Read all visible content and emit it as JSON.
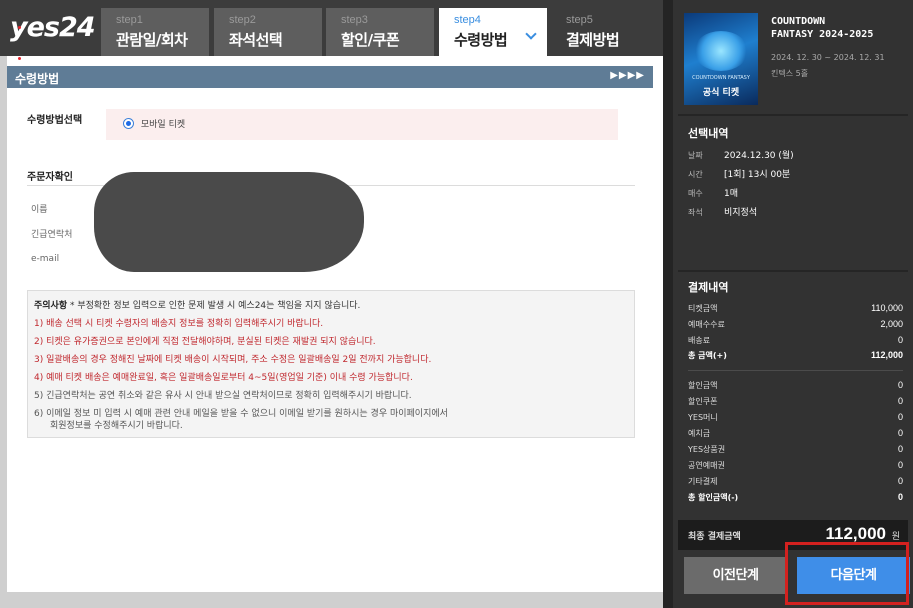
{
  "header": {
    "logo": "yes24",
    "steps": [
      {
        "num": "step1",
        "label": "관람일/회차",
        "state": "gray"
      },
      {
        "num": "step2",
        "label": "좌석선택",
        "state": "gray"
      },
      {
        "num": "step3",
        "label": "할인/쿠폰",
        "state": "gray"
      },
      {
        "num": "step4",
        "label": "수령방법",
        "state": "active"
      },
      {
        "num": "step5",
        "label": "결제방법",
        "state": "dark"
      }
    ]
  },
  "section": {
    "title": "수령방법",
    "arrows": "▶▶▶▶"
  },
  "receive": {
    "label": "수령방법선택",
    "option": "모바일 티켓",
    "selected": true
  },
  "orderer": {
    "title": "주문자확인",
    "fields": [
      "이름",
      "긴급연락처",
      "e-mail"
    ]
  },
  "notice": {
    "title_bold": "주의사항",
    "title_rest": " * 부정확한 정보 입력으로 인한 문제 발생 시 예스24는 책임을 지지 않습니다.",
    "items": [
      "1) 배송 선택 시 티켓 수령자의 배송지 정보를 정확히 입력해주시기 바랍니다.",
      "2) 티켓은 유가증권으로 본인에게 직접 전달해야하며, 분실된 티켓은 재발권 되지 않습니다.",
      "3) 일괄배송의 경우 정해진 날짜에 티켓 배송이 시작되며, 주소 수정은 일괄배송일 2일 전까지 가능합니다.",
      "4) 예매 티켓 배송은 예매완료일, 혹은 일괄배송일로부터 4~5일(영업일 기준) 이내 수령 가능합니다.",
      "5) 긴급연락처는 공연 취소와 같은 유사 시 안내 받으실 연락처이므로 정확히 입력해주시기 바랍니다.",
      "6) 이메일 정보 미 입력 시 예매 관련 안내 메일을 받을 수 없으니 이메일 받기를 원하시는 경우 마이페이지에서"
    ],
    "item6_cont": "회원정보를 수정해주시기 바랍니다."
  },
  "event": {
    "title_line1": "COUNTDOWN",
    "title_line2": "FANTASY 2024-2025",
    "date": "2024. 12. 30 ~ 2024. 12. 31",
    "venue": "킨텍스 5홀",
    "poster_sub": "COUNTDOWN FANTASY",
    "poster_title": "공식 티켓"
  },
  "selection": {
    "heading": "선택내역",
    "rows": [
      {
        "k": "날짜",
        "v": "2024.12.30 (월)"
      },
      {
        "k": "시간",
        "v": "[1회] 13시 00분"
      },
      {
        "k": "매수",
        "v": "1매"
      },
      {
        "k": "좌석",
        "v": "비지정석"
      }
    ]
  },
  "payment": {
    "heading": "결제내역",
    "rows": [
      {
        "k": "티켓금액",
        "v": "110,000"
      },
      {
        "k": "예매수수료",
        "v": "2,000"
      },
      {
        "k": "배송료",
        "v": "0"
      },
      {
        "k": "총 금액(+)",
        "v": "112,000"
      }
    ],
    "discount_rows": [
      {
        "k": "할인금액",
        "v": "0"
      },
      {
        "k": "할인쿠폰",
        "v": "0"
      },
      {
        "k": "YES머니",
        "v": "0"
      },
      {
        "k": "예치금",
        "v": "0"
      },
      {
        "k": "YES상품권",
        "v": "0"
      },
      {
        "k": "공연예매권",
        "v": "0"
      },
      {
        "k": "기타결제",
        "v": "0"
      },
      {
        "k": "총 할인금액(-)",
        "v": "0"
      }
    ],
    "final_label": "최종 결제금액",
    "final_amount": "112,000",
    "currency": "원"
  },
  "buttons": {
    "prev": "이전단계",
    "next": "다음단계"
  },
  "colors": {
    "accent": "#3f8ee8",
    "header_bg": "#3c3c3c",
    "section_bar": "#5f7c96",
    "notice_red": "#c0282e",
    "highlight": "#d3211f"
  }
}
